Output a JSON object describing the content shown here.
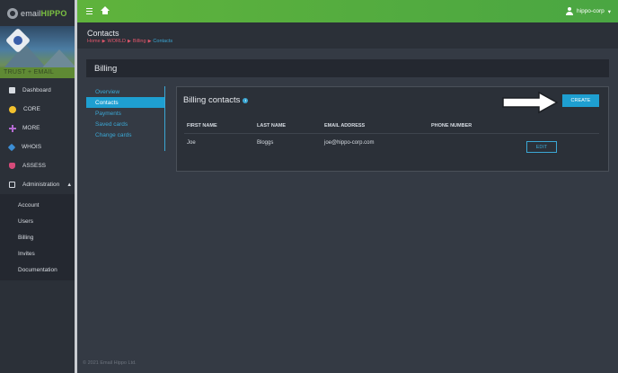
{
  "brand": {
    "prefix": "email",
    "name": "HIPPO"
  },
  "sidebar": {
    "banner_caption": "TRUST + EMAIL",
    "items": [
      {
        "label": "Dashboard",
        "icon": "dashboard-icon"
      },
      {
        "label": "CORE",
        "icon": "core-icon"
      },
      {
        "label": "MORE",
        "icon": "more-icon"
      },
      {
        "label": "WHOIS",
        "icon": "whois-icon"
      },
      {
        "label": "ASSESS",
        "icon": "assess-icon"
      },
      {
        "label": "Administration",
        "icon": "admin-icon",
        "expanded": true
      }
    ],
    "submenu": [
      "Account",
      "Users",
      "Billing",
      "Invites",
      "Documentation"
    ]
  },
  "topbar": {
    "user_label": "hippo-corp"
  },
  "header": {
    "title": "Contacts",
    "breadcrumbs": [
      "Home",
      "WORLD",
      "Billing",
      "Contacts"
    ]
  },
  "billing": {
    "title": "Billing",
    "menu": [
      "Overview",
      "Contacts",
      "Payments",
      "Saved cards",
      "Change cards"
    ],
    "active_menu": "Contacts"
  },
  "contacts": {
    "title": "Billing contacts",
    "create_label": "CREATE",
    "columns": [
      "FIRST NAME",
      "LAST NAME",
      "EMAIL ADDRESS",
      "PHONE NUMBER"
    ],
    "rows": [
      {
        "first": "Joe",
        "last": "Bloggs",
        "email": "joe@hippo-corp.com",
        "phone": "",
        "action": "EDIT"
      }
    ]
  },
  "colors": {
    "accent": "#1e9fd1",
    "topbar": "#5fb33c",
    "breadcrumb": "#e0566b"
  },
  "footer": "© 2021 Email Hippo Ltd."
}
